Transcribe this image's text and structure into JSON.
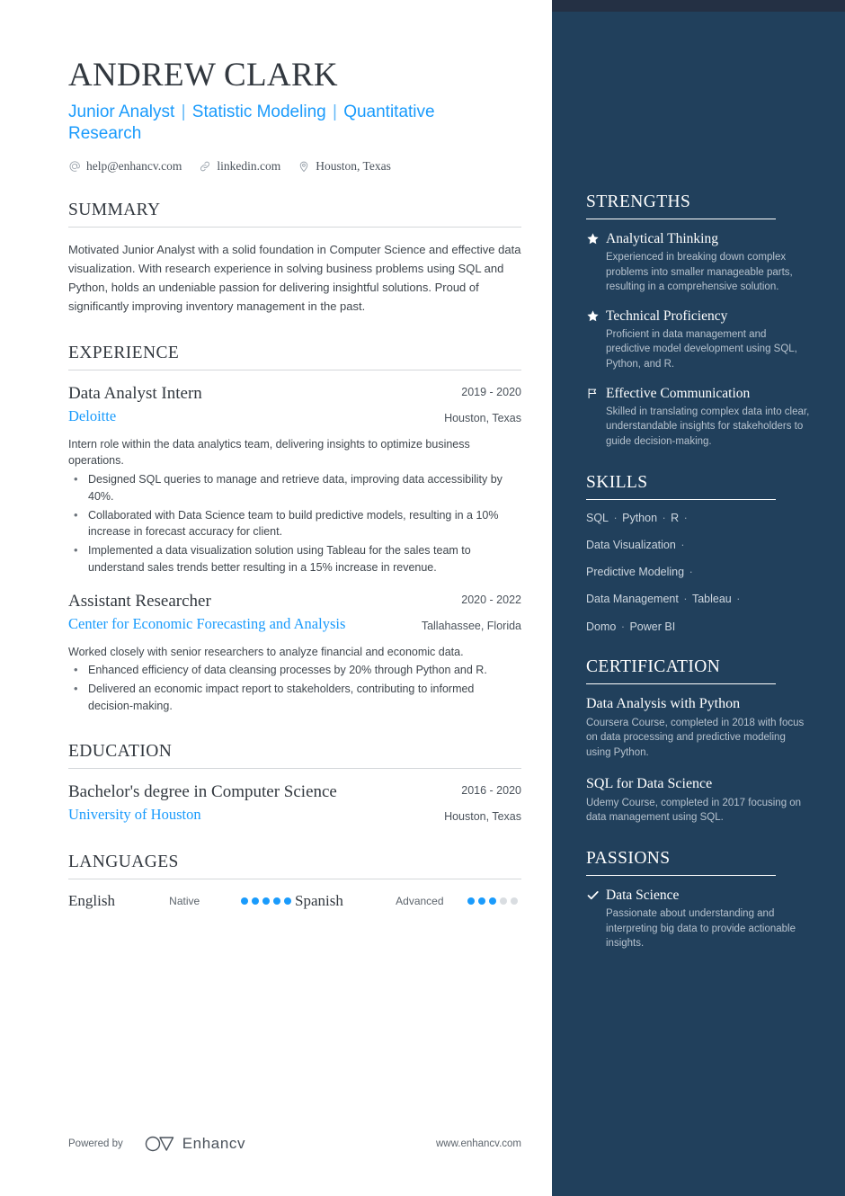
{
  "colors": {
    "sidebar_bg": "#21405c",
    "sidebar_topbar": "#243044",
    "accent_blue": "#1a9bfc",
    "heading_dark": "#32383f"
  },
  "header": {
    "name": "ANDREW CLARK",
    "headline_parts": [
      "Junior Analyst",
      "Statistic Modeling",
      "Quantitative Research"
    ],
    "headline_separator": "|",
    "contacts": [
      {
        "icon": "at-icon",
        "text": "help@enhancv.com"
      },
      {
        "icon": "link-icon",
        "text": "linkedin.com"
      },
      {
        "icon": "location-pin-icon",
        "text": "Houston, Texas"
      }
    ]
  },
  "summary": {
    "heading": "SUMMARY",
    "text": "Motivated Junior Analyst with a solid foundation in Computer Science and effective data visualization. With research experience in solving business problems using SQL and Python, holds an undeniable passion for delivering insightful solutions. Proud of significantly improving inventory management in the past."
  },
  "experience": {
    "heading": "EXPERIENCE",
    "entries": [
      {
        "title": "Data Analyst Intern",
        "org": "Deloitte",
        "date": "2019 - 2020",
        "location": "Houston, Texas",
        "desc": "Intern role within the data analytics team, delivering insights to optimize business operations.",
        "bullets": [
          "Designed SQL queries to manage and retrieve data, improving data accessibility by 40%.",
          "Collaborated with Data Science team to build predictive models, resulting in a 10% increase in forecast accuracy for client.",
          "Implemented a data visualization solution using Tableau for the sales team to understand sales trends better resulting in a 15% increase in revenue."
        ]
      },
      {
        "title": "Assistant Researcher",
        "org": "Center for Economic Forecasting and Analysis",
        "date": "2020 - 2022",
        "location": "Tallahassee, Florida",
        "desc": "Worked closely with senior researchers to analyze financial and economic data.",
        "bullets": [
          "Enhanced efficiency of data cleansing processes by 20% through Python and R.",
          "Delivered an economic impact report to stakeholders, contributing to informed decision-making."
        ]
      }
    ]
  },
  "education": {
    "heading": "EDUCATION",
    "entries": [
      {
        "title": "Bachelor's degree in Computer Science",
        "org": "University of Houston",
        "date": "2016 - 2020",
        "location": "Houston, Texas"
      }
    ]
  },
  "languages": {
    "heading": "LANGUAGES",
    "items": [
      {
        "name": "English",
        "level": "Native",
        "filled": 5,
        "total": 5
      },
      {
        "name": "Spanish",
        "level": "Advanced",
        "filled": 3,
        "total": 5
      }
    ]
  },
  "footer": {
    "powered_by": "Powered by",
    "brand": "Enhancv",
    "website": "www.enhancv.com"
  },
  "sidebar": {
    "strengths": {
      "heading": "STRENGTHS",
      "items": [
        {
          "icon": "star-icon",
          "title": "Analytical Thinking",
          "desc": "Experienced in breaking down complex problems into smaller manageable parts, resulting in a comprehensive solution."
        },
        {
          "icon": "star-icon",
          "title": "Technical Proficiency",
          "desc": "Proficient in data management and predictive model development using SQL, Python, and R."
        },
        {
          "icon": "flag-icon",
          "title": "Effective Communication",
          "desc": "Skilled in translating complex data into clear, understandable insights for stakeholders to guide decision-making."
        }
      ]
    },
    "skills": {
      "heading": "SKILLS",
      "lines": [
        [
          "SQL",
          "Python",
          "R",
          ""
        ],
        [
          "Data Visualization",
          ""
        ],
        [
          "Predictive Modeling",
          ""
        ],
        [
          "Data Management",
          "Tableau",
          ""
        ],
        [
          "Domo",
          "Power BI"
        ]
      ],
      "separator": "·"
    },
    "certification": {
      "heading": "CERTIFICATION",
      "items": [
        {
          "title": "Data Analysis with Python",
          "desc": "Coursera Course, completed in 2018 with focus on data processing and predictive modeling using Python."
        },
        {
          "title": "SQL for Data Science",
          "desc": "Udemy Course, completed in 2017 focusing on data management using SQL."
        }
      ]
    },
    "passions": {
      "heading": "PASSIONS",
      "items": [
        {
          "icon": "check-icon",
          "title": "Data Science",
          "desc": "Passionate about understanding and interpreting big data to provide actionable insights."
        }
      ]
    }
  }
}
